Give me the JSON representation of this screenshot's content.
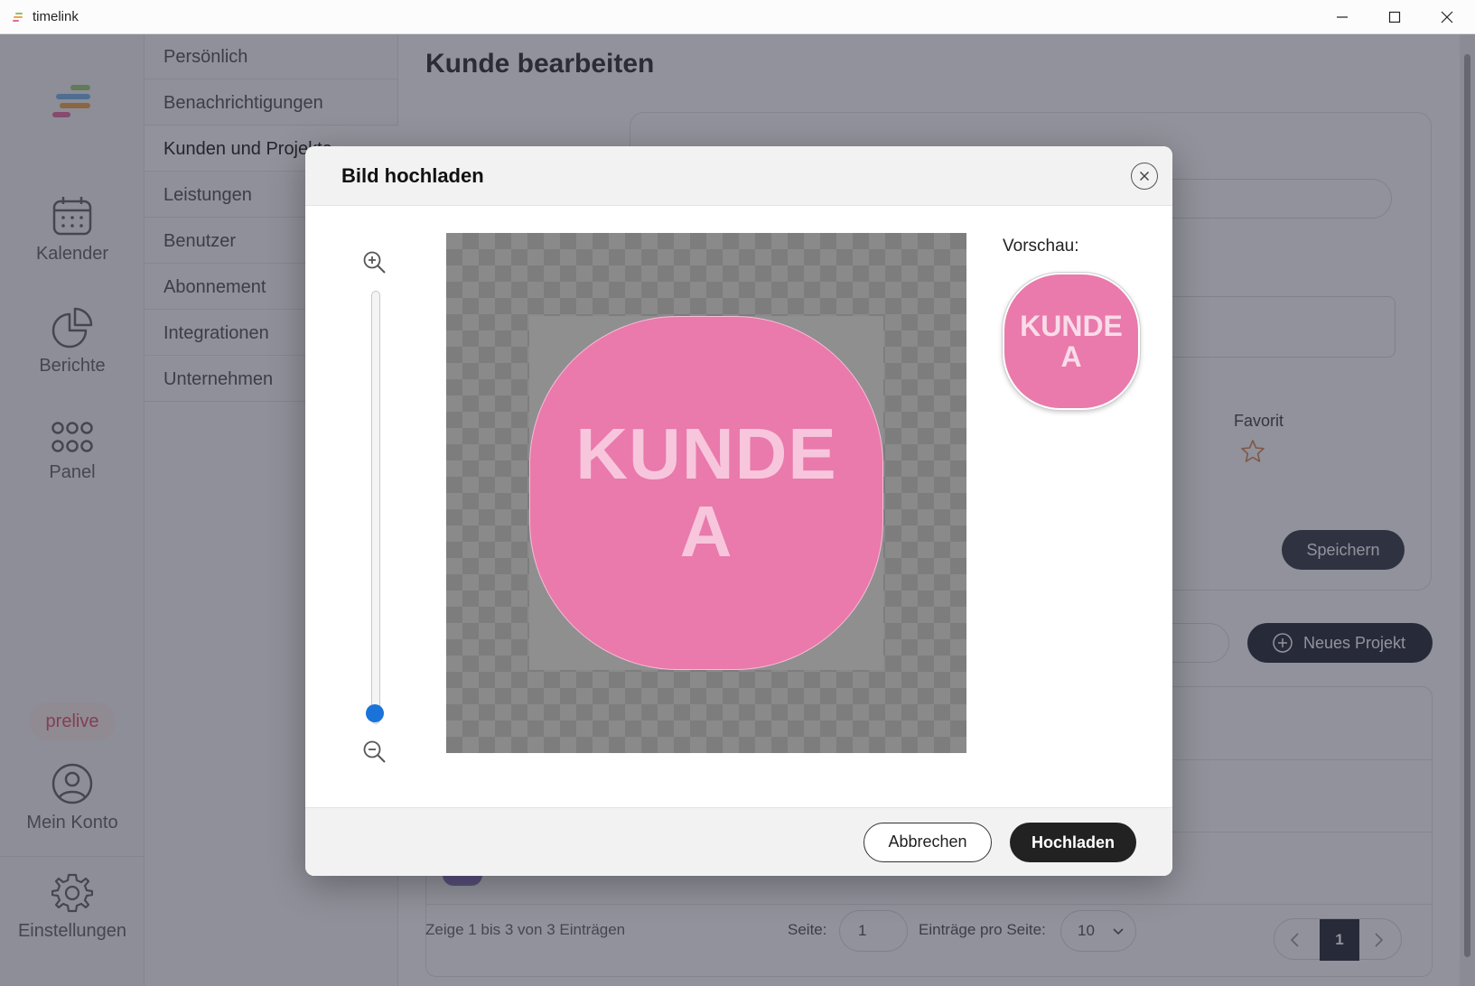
{
  "window": {
    "title": "timelink"
  },
  "nav": {
    "items": [
      {
        "label": "Kalender",
        "icon": "calendar-icon"
      },
      {
        "label": "Berichte",
        "icon": "pie-chart-icon"
      },
      {
        "label": "Panel",
        "icon": "grid-icon"
      }
    ],
    "badge": "prelive",
    "account_label": "Mein Konto",
    "settings_label": "Einstellungen"
  },
  "settings_menu": {
    "items": [
      "Persönlich",
      "Benachrichtigungen",
      "Kunden und Projekte",
      "Leistungen",
      "Benutzer",
      "Abonnement",
      "Integrationen",
      "Unternehmen"
    ],
    "active_index": 2
  },
  "main": {
    "title": "Kunde bearbeiten",
    "favorite_label": "Favorit",
    "save_label": "Speichern",
    "new_project_label": "Neues Projekt",
    "footer": {
      "info": "Zeige 1 bis 3 von 3 Einträgen",
      "page_label": "Seite:",
      "page_value": "1",
      "per_page_label": "Einträge pro Seite:",
      "per_page_value": "10",
      "current_page": "1"
    }
  },
  "dialog": {
    "title": "Bild hochladen",
    "preview_label": "Vorschau:",
    "image_text_line1": "KUNDE",
    "image_text_line2": "A",
    "zoom_level": 0,
    "cancel_label": "Abbrechen",
    "upload_label": "Hochladen"
  },
  "colors": {
    "image_pink": "#e97aab",
    "slider_accent": "#1a73d9",
    "primary_dark": "#222222"
  }
}
